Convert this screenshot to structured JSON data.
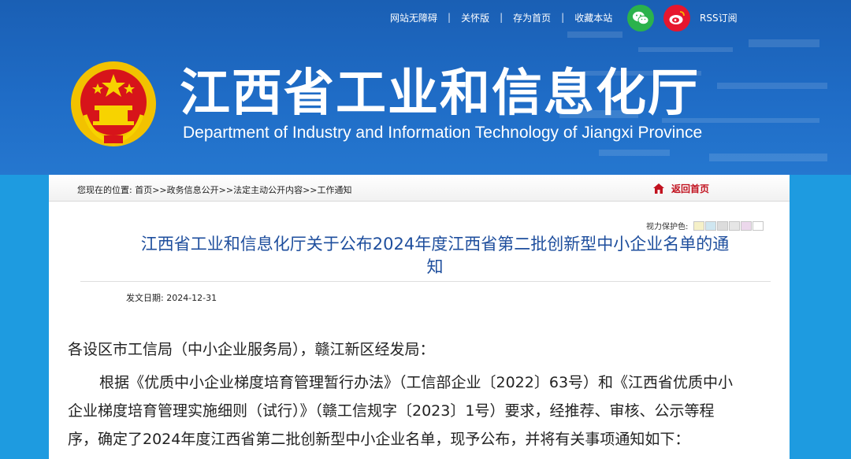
{
  "topnav": {
    "items": [
      "网站无障碍",
      "关怀版",
      "存为首页",
      "收藏本站"
    ],
    "separator": "|",
    "rss": "RSS订阅"
  },
  "header": {
    "title_cn": "江西省工业和信息化厅",
    "title_en": "Department of Industry and Information Technology of Jiangxi Province"
  },
  "breadcrumb": {
    "prefix": "您现在的位置:",
    "items": [
      "首页",
      "政务信息公开",
      "法定主动公开内容",
      "工作通知"
    ],
    "sep": ">>"
  },
  "home_button": "返回首页",
  "vision": {
    "label": "视力保护色:",
    "colors": [
      "#f5f0c8",
      "#cfe6f0",
      "#dcdcdc",
      "#e6e6e6",
      "#ecd8ec",
      "#ffffff"
    ]
  },
  "article": {
    "title_line1": "江西省工业和信息化厅关于公布2024年度江西省第二批创新型中小企业名单的通",
    "title_line2": "知",
    "date": "发文日期: 2024-12-31",
    "salutation": "各设区市工信局（中小企业服务局），赣江新区经发局：",
    "para_line1": "根据《优质中小企业梯度培育管理暂行办法》（工信部企业〔2022〕63号）和《江西省优质中小",
    "para_line2": "企业梯度培育管理实施细则（试行）》（赣工信规字〔2023〕1号）要求，经推荐、审核、公示等程",
    "para_line3": "序，确定了2024年度江西省第二批创新型中小企业名单，现予公布，并将有关事项通知如下："
  }
}
